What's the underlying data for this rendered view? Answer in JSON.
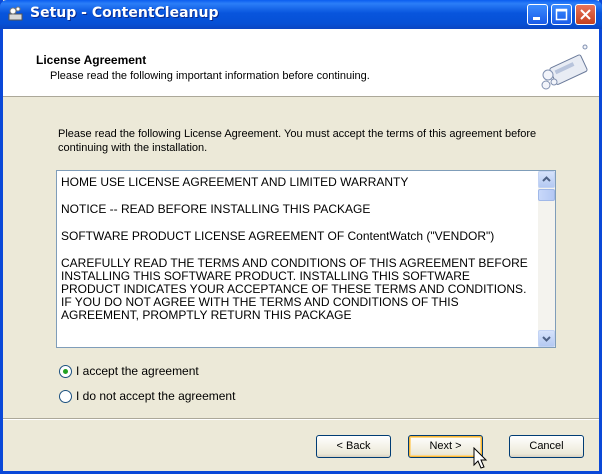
{
  "window": {
    "title": "Setup - ContentCleanup"
  },
  "header": {
    "title": "License Agreement",
    "subtitle": "Please read the following important information before continuing."
  },
  "intro_text": "Please read the following License Agreement. You must accept the terms of this agreement before continuing with the installation.",
  "license": {
    "paragraphs": [
      "HOME USE LICENSE AGREEMENT AND LIMITED WARRANTY",
      "NOTICE -- READ BEFORE INSTALLING THIS PACKAGE",
      "SOFTWARE PRODUCT LICENSE AGREEMENT OF ContentWatch (\"VENDOR\")",
      "CAREFULLY READ THE TERMS AND CONDITIONS OF THIS AGREEMENT BEFORE INSTALLING THIS SOFTWARE PRODUCT. INSTALLING THIS SOFTWARE PRODUCT INDICATES YOUR ACCEPTANCE OF THESE TERMS AND CONDITIONS. IF YOU DO NOT AGREE WITH THE TERMS AND CONDITIONS OF THIS AGREEMENT, PROMPTLY RETURN THIS PACKAGE"
    ]
  },
  "options": {
    "accept": "I accept the agreement",
    "decline": "I do not accept the agreement",
    "selected": "accept"
  },
  "buttons": {
    "back": "< Back",
    "next": "Next >",
    "cancel": "Cancel"
  },
  "icons": {
    "app": "setup-icon",
    "header_art": "installer-disk-icon",
    "cursor": "arrow-cursor-icon"
  }
}
